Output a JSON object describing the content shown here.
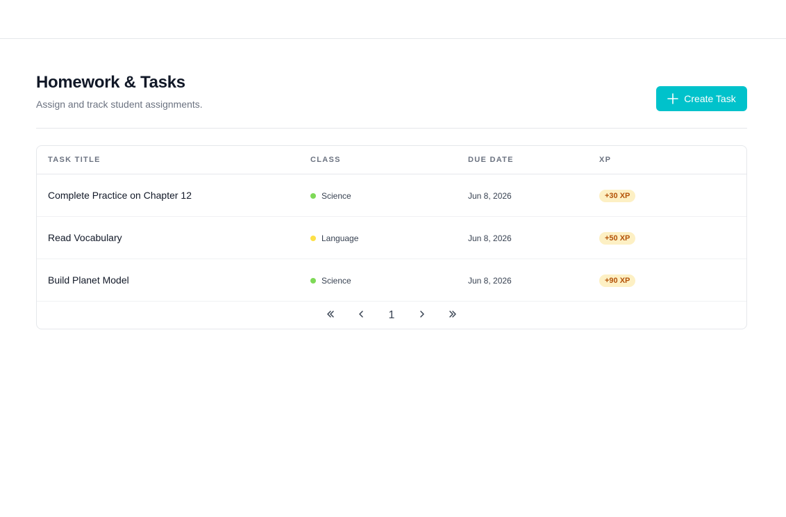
{
  "header": {
    "title": "Homework & Tasks",
    "subtitle": "Assign and track student assignments.",
    "create_label": "Create Task",
    "create_icon": "plus-icon"
  },
  "colors": {
    "accent": "#00c2cb",
    "science": "#7ed957",
    "language": "#fde047",
    "xp_bg": "#fdf0c4",
    "xp_text": "#b45309"
  },
  "table": {
    "columns": [
      "TASK TITLE",
      "CLASS",
      "DUE DATE",
      "XP"
    ],
    "rows": [
      {
        "title": "Complete Practice on Chapter 12",
        "class": "Science",
        "class_color": "#7ed957",
        "due": "Jun 8, 2026",
        "xp": "+30 XP"
      },
      {
        "title": "Read Vocabulary",
        "class": "Language",
        "class_color": "#fde047",
        "due": "Jun 8, 2026",
        "xp": "+50 XP"
      },
      {
        "title": "Build Planet Model",
        "class": "Science",
        "class_color": "#7ed957",
        "due": "Jun 8, 2026",
        "xp": "+90 XP"
      }
    ]
  },
  "pagination": {
    "first_icon": "double-chevron-left-icon",
    "prev_icon": "chevron-left-icon",
    "current_page": "1",
    "next_icon": "chevron-right-icon",
    "last_icon": "double-chevron-right-icon"
  }
}
